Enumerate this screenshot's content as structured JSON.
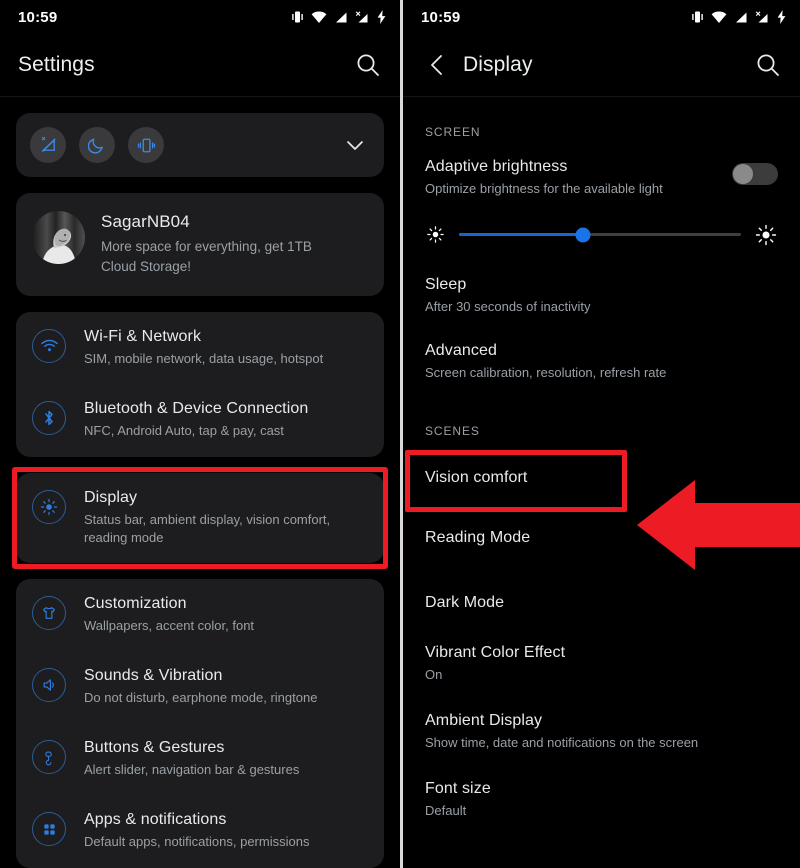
{
  "accent_colors": {
    "highlight_red": "#ed1c24",
    "icon_blue": "#2f7de1",
    "slider_blue": "#1a73e8",
    "card_bg": "#1d1d1f",
    "page_bg": "#000000",
    "title_text": "#e8eaed",
    "subtitle_text": "#9aa0a6"
  },
  "left_screen": {
    "statusbar": {
      "time": "10:59",
      "icons": [
        "vibrate-icon",
        "wifi-icon",
        "signal-icon",
        "signal-no-sim-icon",
        "charging-bolt-icon"
      ]
    },
    "appbar": {
      "title": "Settings",
      "search_icon": "search-icon"
    },
    "quick_toggles": {
      "items": [
        {
          "name": "mute-toggle",
          "icon": "mute-icon"
        },
        {
          "name": "dnd-toggle",
          "icon": "moon-icon"
        },
        {
          "name": "vibrate-toggle",
          "icon": "vibrate-phone-icon"
        }
      ],
      "expand_icon": "chevron-down-icon"
    },
    "profile": {
      "avatar": "user-avatar",
      "name": "SagarNB04",
      "subtitle": "More space for everything, get 1TB Cloud Storage!"
    },
    "groups": [
      {
        "rows": [
          {
            "icon": "wifi-icon",
            "title": "Wi-Fi & Network",
            "subtitle": "SIM, mobile network, data usage, hotspot"
          },
          {
            "icon": "bluetooth-icon",
            "title": "Bluetooth & Device Connection",
            "subtitle": "NFC, Android Auto, tap & pay, cast"
          }
        ]
      },
      {
        "highlighted": true,
        "rows": [
          {
            "icon": "brightness-icon",
            "title": "Display",
            "subtitle": "Status bar, ambient display, vision comfort, reading mode"
          }
        ]
      },
      {
        "rows": [
          {
            "icon": "tshirt-icon",
            "title": "Customization",
            "subtitle": "Wallpapers, accent color, font"
          },
          {
            "icon": "speaker-icon",
            "title": "Sounds & Vibration",
            "subtitle": "Do not disturb, earphone mode, ringtone"
          },
          {
            "icon": "gesture-tap-icon",
            "title": "Buttons & Gestures",
            "subtitle": "Alert slider, navigation bar & gestures"
          },
          {
            "icon": "apps-grid-icon",
            "title": "Apps & notifications",
            "subtitle": "Default apps, notifications, permissions"
          }
        ]
      }
    ]
  },
  "right_screen": {
    "statusbar": {
      "time": "10:59",
      "icons": [
        "vibrate-icon",
        "wifi-icon",
        "signal-icon",
        "signal-no-sim-icon",
        "charging-bolt-icon"
      ]
    },
    "appbar": {
      "back_icon": "back-chevron-icon",
      "title": "Display",
      "search_icon": "search-icon"
    },
    "sections": [
      {
        "label": "SCREEN",
        "rows": [
          {
            "title": "Adaptive brightness",
            "subtitle": "Optimize brightness for the available light",
            "control": "toggle",
            "toggle_state": "off"
          },
          {
            "title": "Sleep",
            "subtitle": "After 30 seconds of inactivity"
          },
          {
            "title": "Advanced",
            "subtitle": "Screen calibration, resolution, refresh rate"
          }
        ],
        "brightness_slider": {
          "low_icon": "brightness-low-icon",
          "high_icon": "brightness-high-icon",
          "value_percent": 44
        }
      },
      {
        "label": "SCENES",
        "rows": [
          {
            "title": "Vision comfort",
            "subtitle": "",
            "highlighted": true
          },
          {
            "title": "Reading Mode",
            "subtitle": ""
          },
          {
            "title": "Dark Mode",
            "subtitle": ""
          },
          {
            "title": "Vibrant Color Effect",
            "subtitle": "On"
          },
          {
            "title": "Ambient Display",
            "subtitle": "Show time, date and notifications on the screen"
          },
          {
            "title": "Font size",
            "subtitle": "Default"
          }
        ]
      }
    ],
    "annotation": {
      "arrow": "left-pointing-arrow",
      "color": "#ed1c24"
    }
  }
}
